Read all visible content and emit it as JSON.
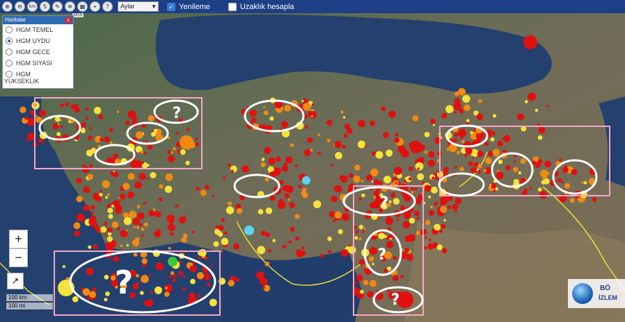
{
  "toolbar": {
    "buttons": [
      "zoom-in-icon",
      "zoom-out-icon",
      "distance-icon",
      "search-icon",
      "draw-icon",
      "layers-icon",
      "grid-icon",
      "locate-icon",
      "help-icon"
    ],
    "button_glyphs": [
      "⊕",
      "⊖",
      "km",
      "S",
      "✎",
      "≋",
      "▦",
      "⌖",
      "?"
    ],
    "period_value": "Aylar",
    "refresh_label": "Yenileme",
    "refresh_checked": true,
    "distance_label": "Uzaklık hesapla",
    "distance_checked": false
  },
  "map_badge": "MTA",
  "layers_panel": {
    "title": "Haritalar",
    "close_glyph": "x",
    "options": [
      {
        "label": "HGM TEMEL",
        "selected": false
      },
      {
        "label": "HGM UYDU",
        "selected": true
      },
      {
        "label": "HGM GECE",
        "selected": false
      },
      {
        "label": "HGM SIYASI",
        "selected": false
      },
      {
        "label": "HGM",
        "selected": false
      }
    ],
    "overflow_label": "YUKSEKLIK"
  },
  "zoom": {
    "in": "+",
    "out": "−"
  },
  "fullscreen_glyph": "↗",
  "scale": {
    "km": "100 km",
    "mi": "100 mi"
  },
  "logo": {
    "line1": "BÖ",
    "line2": "İZLEM"
  },
  "annotations": {
    "question_mark": "?"
  },
  "colors": {
    "sea": "#23406f",
    "toolbar": "#1d3f86",
    "quake_red": "#e01010",
    "quake_orange": "#f28a12",
    "quake_yellow": "#f5e23a",
    "highlight_box": "#f4a9c8",
    "circle": "#ffffff"
  }
}
